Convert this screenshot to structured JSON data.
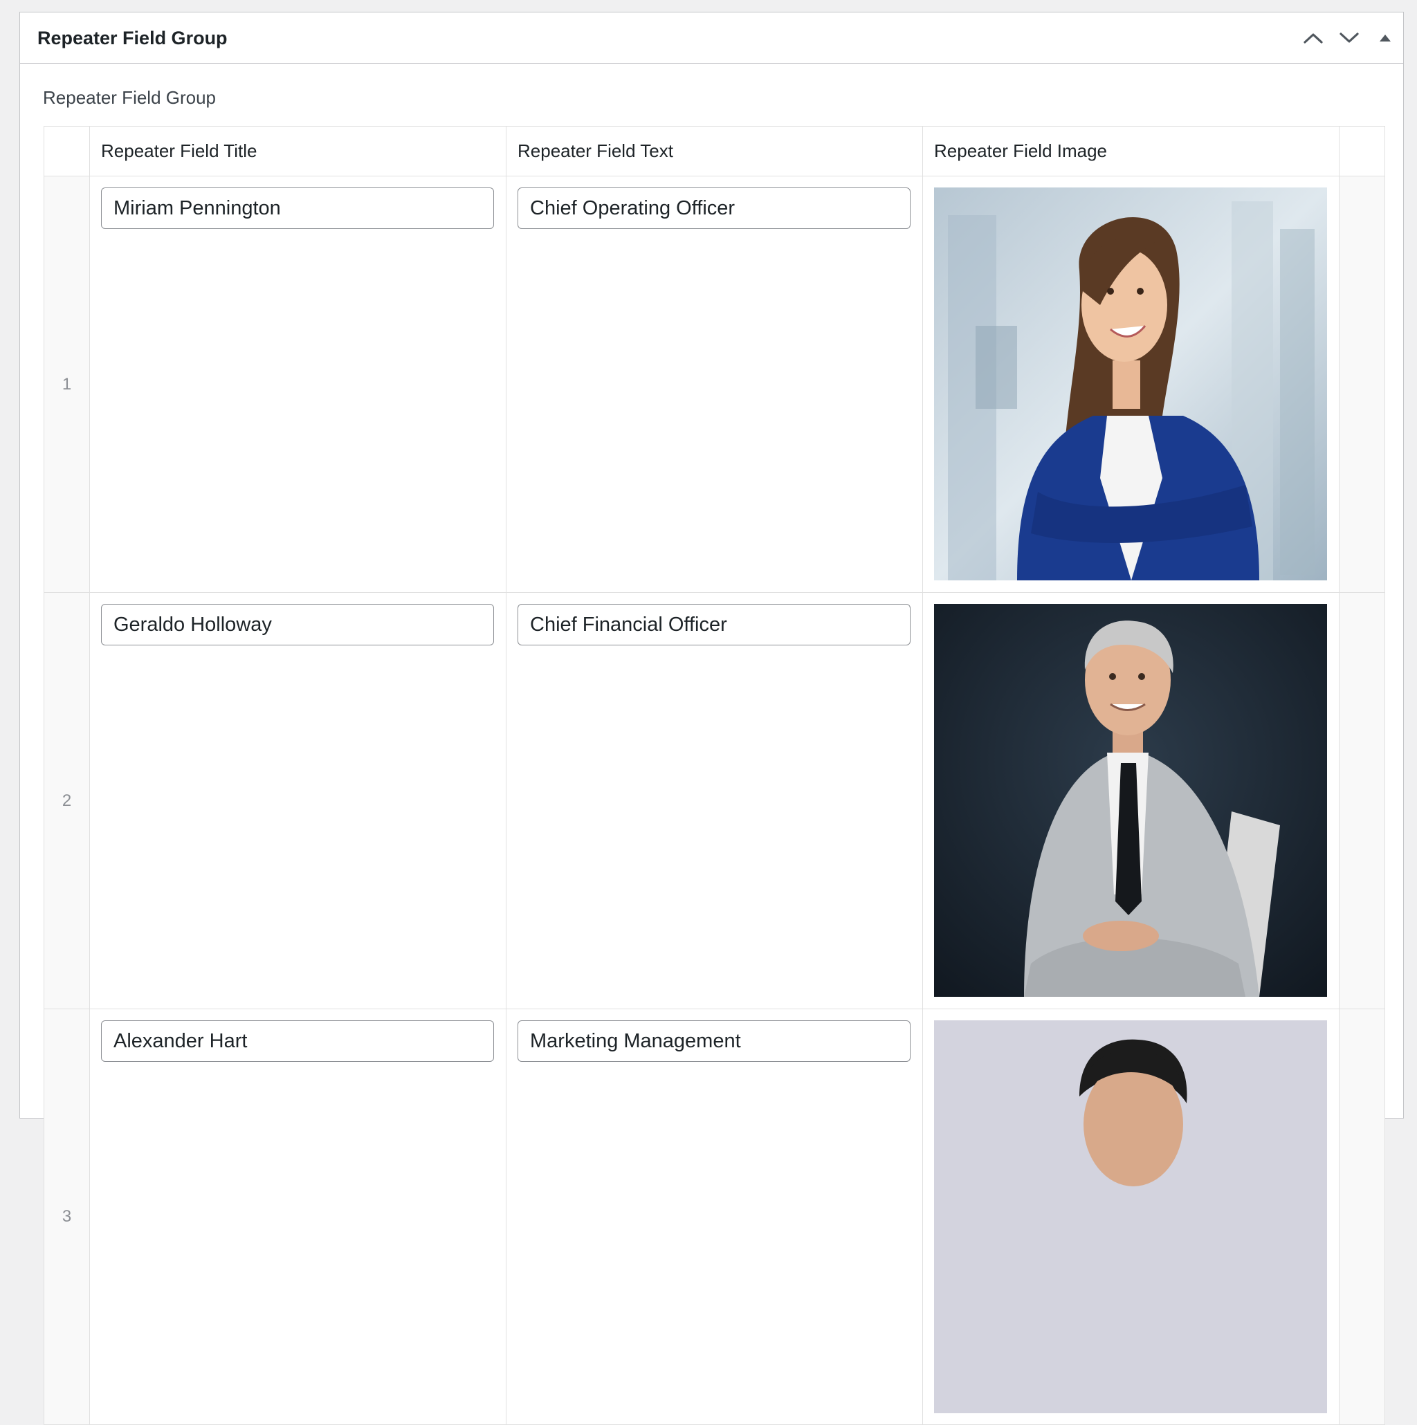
{
  "panel": {
    "title": "Repeater Field Group",
    "controls": [
      {
        "name": "move-up-icon",
        "glyph": "chevron-up"
      },
      {
        "name": "move-down-icon",
        "glyph": "chevron-down"
      },
      {
        "name": "toggle-panel-icon",
        "glyph": "triangle-up"
      }
    ]
  },
  "field": {
    "label": "Repeater Field Group"
  },
  "table": {
    "columns": [
      "Repeater Field Title",
      "Repeater Field Text",
      "Repeater Field Image"
    ],
    "rows": [
      {
        "order": "1",
        "title": "Miriam Pennington",
        "text": "Chief Operating Officer",
        "image": {
          "icon": "woman-portrait",
          "background": "#c9d6df",
          "accent": "#1a3b8f"
        }
      },
      {
        "order": "2",
        "title": "Geraldo Holloway",
        "text": "Chief Financial Officer",
        "image": {
          "icon": "man-portrait",
          "background": "#1e2a36",
          "accent": "#b8bcc0"
        }
      },
      {
        "order": "3",
        "title": "Alexander Hart",
        "text": "Marketing Management",
        "image": {
          "icon": "man-portrait-partial",
          "background": "#d3d3de",
          "accent": "#1c1c1c"
        }
      }
    ]
  },
  "colors": {
    "page_background": "#f0f0f1",
    "panel_border": "#c3c4c7",
    "input_border": "#8c8f94",
    "order_text": "#8c8f94"
  }
}
